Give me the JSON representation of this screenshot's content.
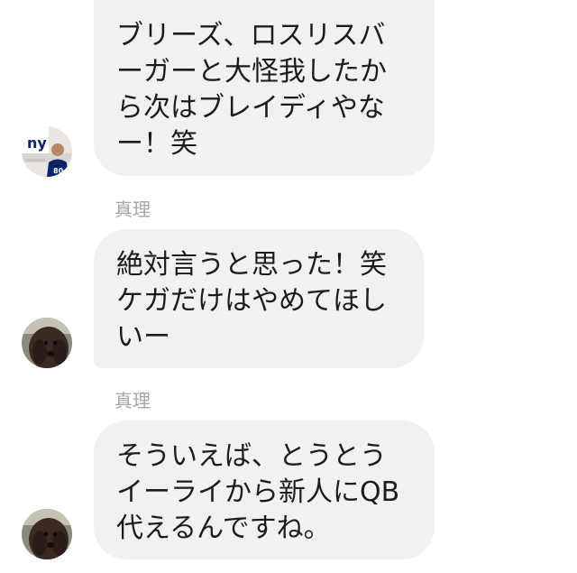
{
  "messages": [
    {
      "sender": "",
      "avatar": "giants-player-avatar",
      "lines": [
        "ブリーズ、ロスリスバ",
        "ーガーと大怪我したか",
        "ら次はブレイディやな",
        "ー！笑"
      ]
    },
    {
      "sender": "真理",
      "avatar": "dog-avatar",
      "lines": [
        "絶対言うと思った！笑",
        "ケガだけはやめてほし",
        "いー"
      ]
    },
    {
      "sender": "真理",
      "avatar": "dog-avatar",
      "lines": [
        "そういえば、とうとう",
        "イーライから新人にQB",
        "代えるんですね。"
      ]
    }
  ],
  "colors": {
    "bubble_bg": "#f1f1f1",
    "text": "#1c1c1e",
    "sender_name": "#a6a6a6",
    "giants_blue": "#0b2265"
  }
}
